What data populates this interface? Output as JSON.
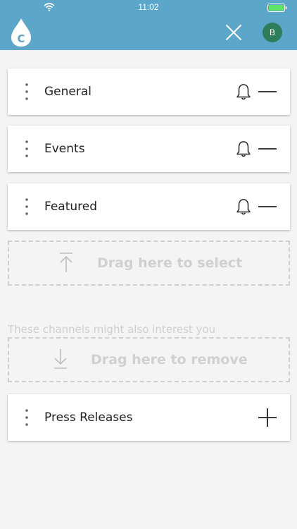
{
  "status_bar": {
    "time": "11:02",
    "wifi_icon": "wifi-icon",
    "battery_icon": "battery-icon"
  },
  "header": {
    "logo_icon": "droplet-c-logo",
    "logo_letter": "C",
    "close_icon": "close-icon",
    "avatar_initial": "B",
    "background_color": "#5ba6c9",
    "avatar_color": "#2e7d5b"
  },
  "selected_channels": [
    {
      "label": "General",
      "icons": [
        "drag-handle-icon",
        "bell-icon",
        "minus-icon"
      ]
    },
    {
      "label": "Events",
      "icons": [
        "drag-handle-icon",
        "bell-icon",
        "minus-icon"
      ]
    },
    {
      "label": "Featured",
      "icons": [
        "drag-handle-icon",
        "bell-icon",
        "minus-icon"
      ]
    }
  ],
  "select_zone": {
    "label": "Drag here to select",
    "icon": "arrow-up-icon"
  },
  "suggested_section": {
    "label": "These channels might also interest you"
  },
  "remove_zone": {
    "label": "Drag here to remove",
    "icon": "arrow-down-icon"
  },
  "suggested_channels": [
    {
      "label": "Press Releases",
      "icons": [
        "drag-handle-icon",
        "plus-icon"
      ]
    }
  ]
}
